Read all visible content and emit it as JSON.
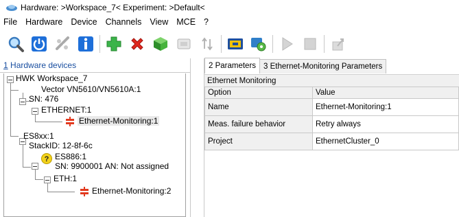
{
  "title": {
    "text": "Hardware: >Workspace_7<   Experiment: >Default<"
  },
  "menu": [
    "File",
    "Hardware",
    "Device",
    "Channels",
    "View",
    "MCE",
    "?"
  ],
  "toolbar": {
    "icons": [
      "search-icon",
      "power-icon",
      "disconnect-icon",
      "info-icon",
      "add-icon",
      "delete-icon",
      "cube-icon",
      "device-icon",
      "sort-icon",
      "board-icon",
      "settings-icon",
      "play-icon",
      "stop-icon",
      "export-icon"
    ]
  },
  "left_panel": {
    "header": "Hardware devices",
    "header_num": "1",
    "tree": {
      "root": "HWK Workspace_7",
      "n1": "Vector VN5610/VN5610A:1",
      "n1a": "SN: 476",
      "n2": "ETHERNET:1",
      "n3": "Ethernet-Monitoring:1",
      "n4": "ES8xx:1",
      "n5": "StackID: 12-8f-6c",
      "n6": "ES886:1",
      "n6a": "SN: 9900001 AN: Not assigned",
      "n7": "ETH:1",
      "n8": "Ethernet-Monitoring:2"
    }
  },
  "right_panel": {
    "tabs": [
      "2 Parameters",
      "3 Ethernet-Monitoring Parameters"
    ],
    "section": "Ethernet Monitoring",
    "columns": [
      "Option",
      "Value"
    ],
    "rows": [
      {
        "option": "Name",
        "value": "Ethernet-Monitoring:1"
      },
      {
        "option": "Meas. failure behavior",
        "value": "Retry always"
      },
      {
        "option": "Project",
        "value": "EthernetCluster_0"
      }
    ]
  }
}
